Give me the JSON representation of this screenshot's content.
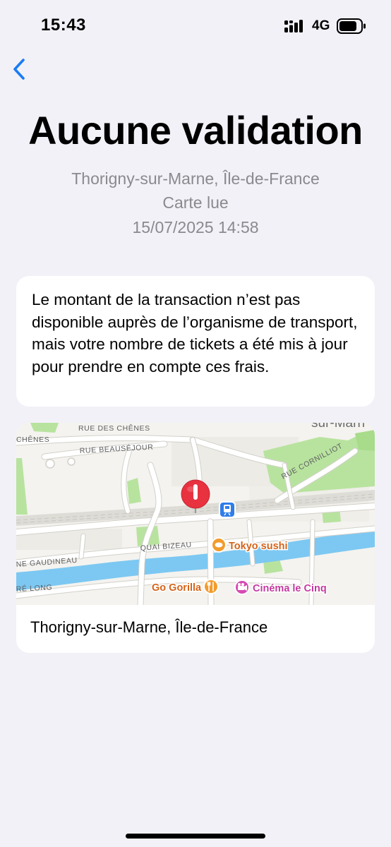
{
  "status_bar": {
    "time": "15:43",
    "network": "4G",
    "signal_icon": "signal-bars-icon",
    "battery_icon": "battery-icon"
  },
  "nav": {
    "back_icon": "chevron-left-icon",
    "accent_color": "#1a7cf5"
  },
  "header": {
    "title": "Aucune validation",
    "location": "Thorigny-sur-Marne, Île-de-France",
    "status": "Carte lue",
    "datetime": "15/07/2025 14:58"
  },
  "info_card": {
    "text": "Le montant de la transaction n’est pas disponible auprès de l’organisme de transport, mais votre nombre de tickets a été mis à jour pour prendre en compte ces frais."
  },
  "map": {
    "street_labels": {
      "rue_des_chenes": "RUE DES CHÊNES",
      "chenes": "CHÊNES",
      "rue_beausejour": "RUE BEAUSÉJOUR",
      "sur_marne": "sur-Marn",
      "rue_cornilliot": "RUE CORNILLIOT",
      "quai_bizeau": "QUAI BIZEAU",
      "ne_gaudineau": "NE GAUDINEAU",
      "re_long": "RÉ LONG"
    },
    "pois": {
      "tokyo_sushi": "Tokyo sushi",
      "go_gorilla": "Go Gorilla",
      "cinema": "Cinéma le Cinq"
    },
    "colors": {
      "water": "#7cc8f2",
      "park": "#b8e39f",
      "pin": "#e8323f",
      "train": "#2f7dea",
      "food": "#f39b2c",
      "cinema": "#d64bb3"
    },
    "caption": "Thorigny-sur-Marne, Île-de-France"
  }
}
